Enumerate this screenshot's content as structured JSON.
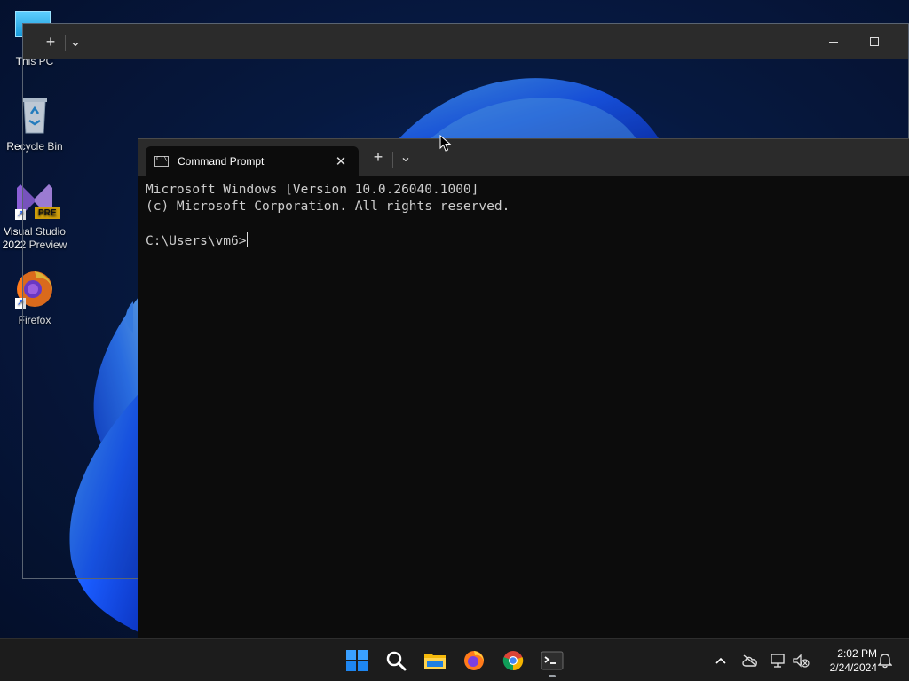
{
  "desktop": {
    "icons": [
      {
        "label": "This PC",
        "icon": "monitor-icon"
      },
      {
        "label": "Recycle Bin",
        "icon": "recycle-bin-icon"
      },
      {
        "label": "Visual Studio 2022 Preview",
        "line1": "Visual Studio",
        "line2": "2022 Preview",
        "badge": "PRE",
        "icon": "visual-studio-icon"
      },
      {
        "label": "Firefox",
        "icon": "firefox-icon"
      }
    ]
  },
  "back_window": {
    "new_tab": "+",
    "dropdown": "⌄",
    "minimize": "—",
    "maximize": "☐"
  },
  "cmd_window": {
    "tab_title": "Command Prompt",
    "tab_close": "✕",
    "new_tab": "+",
    "dropdown": "⌄",
    "console_lines": [
      "Microsoft Windows [Version 10.0.26040.1000]",
      "(c) Microsoft Corporation. All rights reserved.",
      "",
      "C:\\Users\\vm6>"
    ]
  },
  "taskbar": {
    "apps": [
      {
        "name": "Start",
        "icon": "windows-start-icon"
      },
      {
        "name": "Search",
        "icon": "search-icon"
      },
      {
        "name": "File Explorer",
        "icon": "folder-icon"
      },
      {
        "name": "Firefox",
        "icon": "firefox-icon"
      },
      {
        "name": "Chrome",
        "icon": "chrome-icon"
      },
      {
        "name": "Terminal",
        "icon": "terminal-icon",
        "running": true
      }
    ],
    "tray": {
      "chevron": "^",
      "time": "2:02 PM",
      "date": "2/24/2024"
    }
  },
  "colors": {
    "accent_blue": "#1f6bff",
    "console_bg": "#0c0c0c",
    "titlebar": "#2b2b2b",
    "taskbar": "#1c1c1c"
  }
}
